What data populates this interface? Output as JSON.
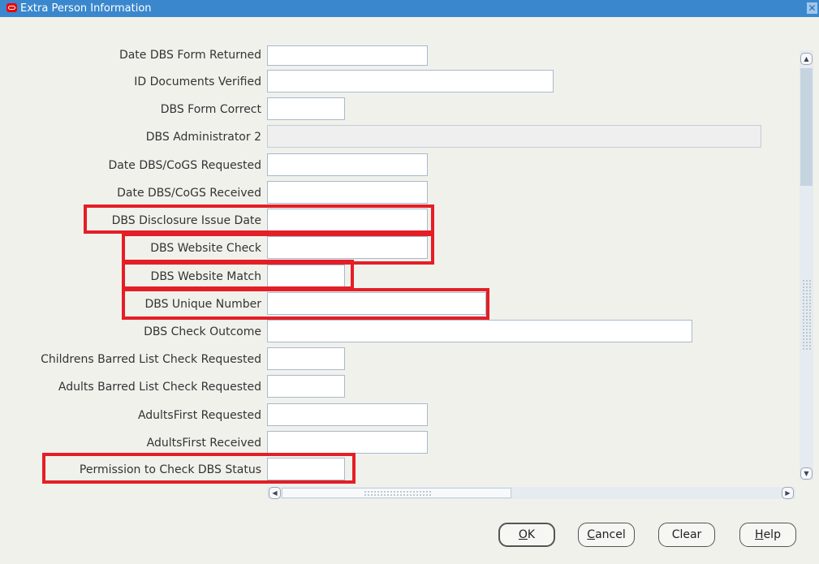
{
  "window": {
    "title": "Extra Person Information",
    "close_glyph": "✕"
  },
  "form": {
    "fields": [
      {
        "label": "Date DBS Form Returned",
        "value": ""
      },
      {
        "label": "ID Documents Verified",
        "value": ""
      },
      {
        "label": "DBS Form Correct",
        "value": ""
      },
      {
        "label": "DBS Administrator 2",
        "value": ""
      },
      {
        "label": "Date DBS/CoGS Requested",
        "value": ""
      },
      {
        "label": "Date DBS/CoGS Received",
        "value": ""
      },
      {
        "label": "DBS Disclosure Issue Date",
        "value": ""
      },
      {
        "label": "DBS Website Check",
        "value": ""
      },
      {
        "label": "DBS Website Match",
        "value": ""
      },
      {
        "label": "DBS Unique Number",
        "value": ""
      },
      {
        "label": "DBS Check Outcome",
        "value": ""
      },
      {
        "label": "Childrens Barred List Check Requested",
        "value": ""
      },
      {
        "label": "Adults Barred List Check Requested",
        "value": ""
      },
      {
        "label": "AdultsFirst Requested",
        "value": ""
      },
      {
        "label": "AdultsFirst Received",
        "value": ""
      },
      {
        "label": "Permission to Check DBS Status",
        "value": ""
      }
    ]
  },
  "scrollbars": {
    "up_arrow": "▲",
    "down_arrow": "▼",
    "left_arrow": "◀",
    "right_arrow": "▶",
    "vertical_position": 0
  },
  "buttons": {
    "ok": {
      "mnemonic": "O",
      "rest": "K"
    },
    "cancel": {
      "mnemonic": "C",
      "rest": "ancel"
    },
    "clear": {
      "label": "Clear"
    },
    "help": {
      "mnemonic": "H",
      "rest": "elp"
    }
  },
  "colors": {
    "titlebar": "#3a87cd",
    "highlight": "#e41e26",
    "background": "#f1f1ec"
  }
}
